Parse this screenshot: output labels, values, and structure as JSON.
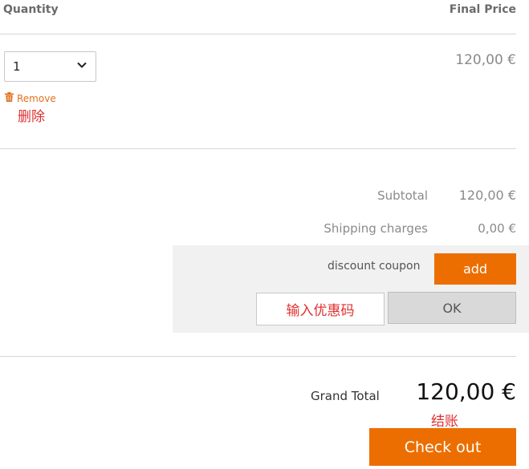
{
  "table_header": {
    "quantity_label": "Quantity",
    "final_price_label": "Final Price"
  },
  "line_item": {
    "quantity": "1",
    "price": "120,00 €",
    "remove_label": "Remove",
    "remove_note": "删除",
    "icons": {
      "dropdown": "chevron-down-icon",
      "remove": "trash-icon"
    }
  },
  "summary": {
    "subtotal_label": "Subtotal",
    "subtotal_value": "120,00 €",
    "shipping_label": "Shipping charges",
    "shipping_value": "0,00 €"
  },
  "coupon": {
    "label": "discount coupon",
    "add_label": "add",
    "input_hint": "输入优惠码",
    "ok_label": "OK"
  },
  "total": {
    "label": "Grand Total",
    "value": "120,00 €",
    "checkout_note": "结账",
    "checkout_label": "Check out"
  },
  "colors": {
    "accent": "#ec6e00",
    "annotation": "#e03030",
    "muted_text": "#8a8a8a",
    "divider": "#d6d6d6"
  }
}
